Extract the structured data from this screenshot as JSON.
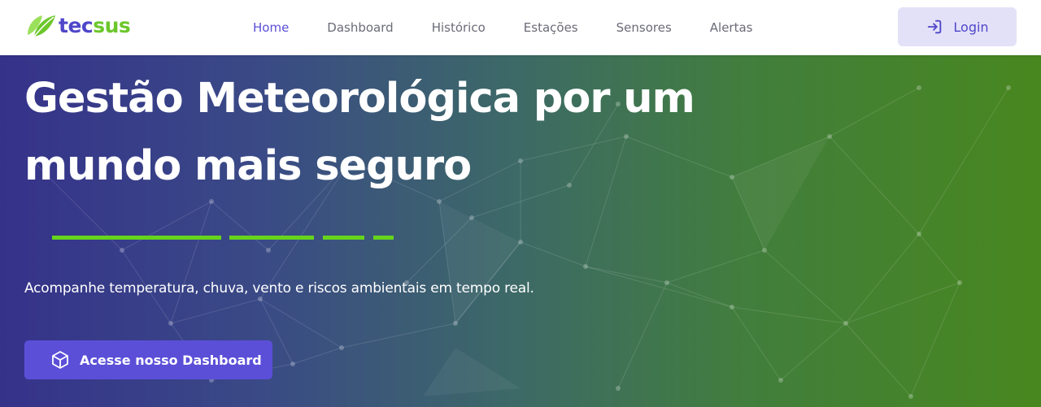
{
  "brand": {
    "tec": "tec",
    "sus": "sus"
  },
  "nav": {
    "items": [
      {
        "label": "Home",
        "active": true
      },
      {
        "label": "Dashboard"
      },
      {
        "label": "Histórico"
      },
      {
        "label": "Estações"
      },
      {
        "label": "Sensores"
      },
      {
        "label": "Alertas"
      }
    ],
    "login_label": "Login"
  },
  "hero": {
    "title_line1": "Gestão Meteorológica por um",
    "title_line2": "mundo mais seguro",
    "subtitle": "Acompanhe temperatura, chuva, vento e riscos ambientais em tempo real.",
    "cta_label": "Acesse nosso Dashboard"
  },
  "icons": {
    "logo": "leaf-logo-icon",
    "login": "login-arrow-icon",
    "cta": "cube-icon"
  },
  "colors": {
    "brand_purple": "#4f46c9",
    "brand_green": "#6cc72a",
    "nav_active": "#5a4fd6",
    "login_bg": "#e3e1f7",
    "cta_bg": "#5b4fd8",
    "divider": "#66d41c",
    "hero_gradient_start": "#35328a",
    "hero_gradient_end": "#48871f"
  }
}
